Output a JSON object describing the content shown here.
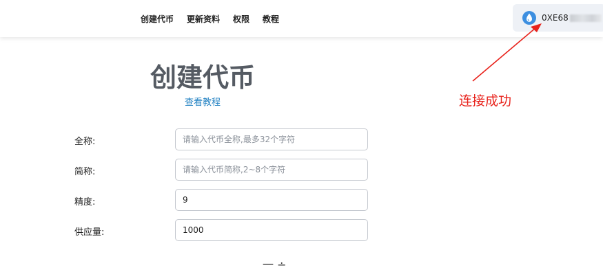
{
  "nav": {
    "items": [
      {
        "label": "创建代币"
      },
      {
        "label": "更新资料"
      },
      {
        "label": "权限"
      },
      {
        "label": "教程"
      }
    ]
  },
  "wallet": {
    "icon": "droplet-icon",
    "address_prefix": "0XE68",
    "ellipsis": "·",
    "icon_color": "#3d8fe0"
  },
  "page": {
    "title": "创建代币",
    "tutorial_link": "查看教程"
  },
  "form": {
    "full_name": {
      "label": "全称:",
      "placeholder": "请输入代币全称,最多32个字符",
      "value": ""
    },
    "short_name": {
      "label": "简称:",
      "placeholder": "请输入代币简称,2~8个字符",
      "value": ""
    },
    "precision": {
      "label": "精度:",
      "placeholder": "",
      "value": "9"
    },
    "supply": {
      "label": "供应量:",
      "placeholder": "",
      "value": "1000"
    },
    "submit_label_partial": "一 ∸"
  },
  "annotation": {
    "text": "连接成功",
    "color": "#e8221b"
  }
}
